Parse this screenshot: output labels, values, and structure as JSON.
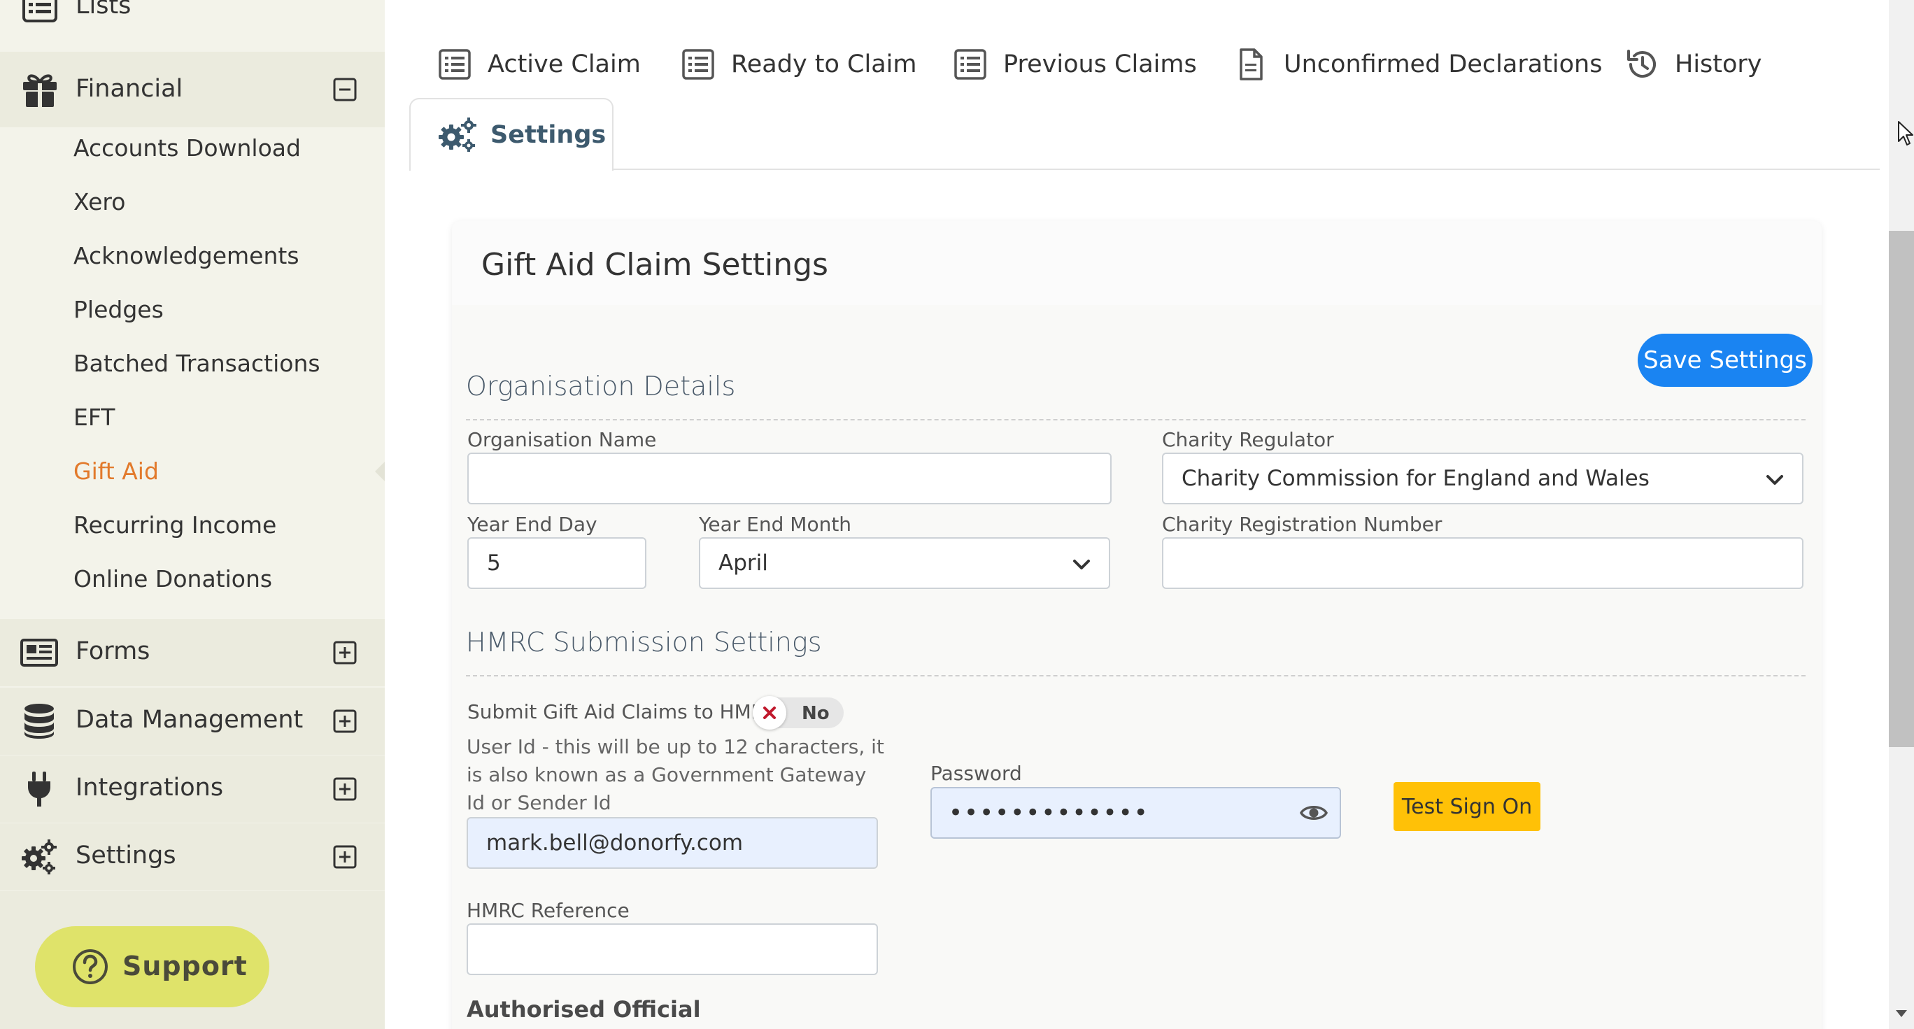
{
  "sidebar": {
    "lists_label": "Lists",
    "financial_label": "Financial",
    "financial_items": [
      "Accounts Download",
      "Xero",
      "Acknowledgements",
      "Pledges",
      "Batched Transactions",
      "EFT",
      "Gift Aid",
      "Recurring Income",
      "Online Donations"
    ],
    "active_item": "Gift Aid",
    "forms_label": "Forms",
    "data_management_label": "Data Management",
    "integrations_label": "Integrations",
    "settings_label": "Settings",
    "support_label": "Support",
    "support_color": "#dfe36a",
    "active_color": "#e27a2c"
  },
  "tabs": {
    "active_claim": "Active Claim",
    "ready_to_claim": "Ready to Claim",
    "previous_claims": "Previous Claims",
    "unconfirmed_declarations": "Unconfirmed Declarations",
    "history": "History",
    "settings": "Settings"
  },
  "card": {
    "title": "Gift Aid Claim Settings",
    "save_button": "Save Settings",
    "save_color": "#1a84f2"
  },
  "organisation": {
    "section_title": "Organisation Details",
    "name_label": "Organisation Name",
    "name_value": "",
    "regulator_label": "Charity Regulator",
    "regulator_value": "Charity Commission for England and Wales",
    "year_end_day_label": "Year End Day",
    "year_end_day_value": "5",
    "year_end_month_label": "Year End Month",
    "year_end_month_value": "April",
    "registration_label": "Charity Registration Number",
    "registration_value": ""
  },
  "hmrc": {
    "section_title": "HMRC Submission Settings",
    "submit_label": "Submit Gift Aid Claims to HMRC",
    "submit_toggle": "No",
    "userid_help": "User Id - this will be up to 12 characters, it is also known as a Government Gateway Id or Sender Id",
    "userid_value": "mark.bell@donorfy.com",
    "password_label": "Password",
    "password_value": "•••••••••••••",
    "test_button": "Test Sign On",
    "test_color": "#ffc107",
    "reference_label": "HMRC Reference",
    "reference_value": "",
    "authorised_heading": "Authorised Official"
  }
}
